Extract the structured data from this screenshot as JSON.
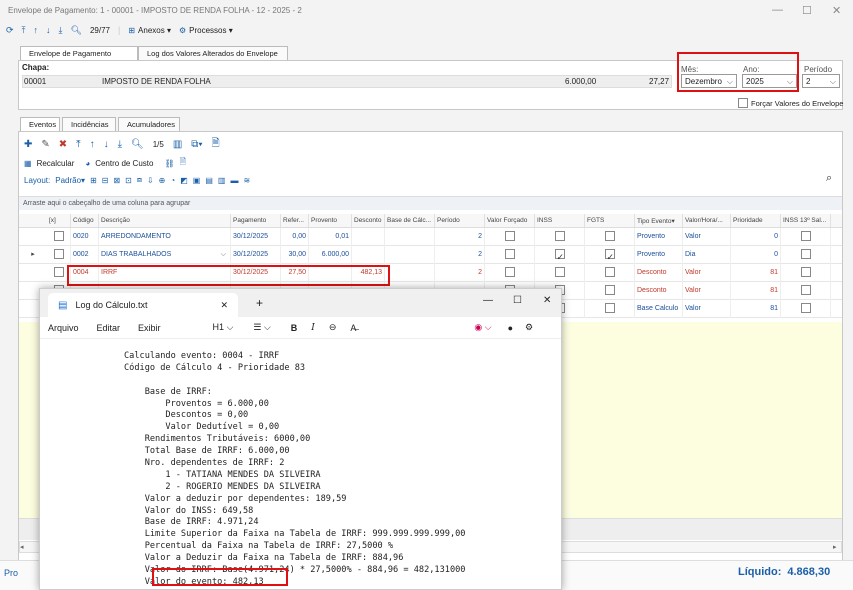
{
  "window": {
    "title": "Envelope de Pagamento: 1 - 00001 - IMPOSTO DE RENDA FOLHA - 12 - 2025 - 2"
  },
  "toolbar": {
    "nav": "29/77",
    "anexos": "Anexos",
    "processos": "Processos"
  },
  "tabs": [
    "Envelope de Pagamento",
    "Log dos Valores Alterados do Envelope"
  ],
  "chapa": {
    "label": "Chapa:",
    "code": "00001",
    "name": "IMPOSTO DE RENDA FOLHA",
    "value1": "6.000,00",
    "value2": "27,27"
  },
  "period": {
    "mes_label": "Mês:",
    "mes": "Dezembro",
    "ano_label": "Ano:",
    "ano": "2025",
    "periodo_label": "Período",
    "periodo": "2",
    "forcar": "Forçar Valores do Envelope"
  },
  "subtabs": [
    "Eventos",
    "Incidências",
    "Acumuladores"
  ],
  "grid_toolbar": {
    "nav": "1/5",
    "recalcular": "Recalcular",
    "centro": "Centro de Custo",
    "layout": "Layout:",
    "padrao": "Padrão"
  },
  "group_hint": "Arraste aqui o cabeçalho de uma coluna para agrupar",
  "columns": [
    "[x]",
    "Código",
    "Descrição",
    "Pagamento",
    "Refer...",
    "Provento",
    "Desconto",
    "Base de Cálc...",
    "Período",
    "Valor Forçado",
    "INSS",
    "FGTS",
    "Tipo Evento",
    "Valor/Hora/...",
    "Prioridade",
    "INSS 13º Sal..."
  ],
  "rows": [
    {
      "codigo": "0020",
      "descricao": "ARREDONDAMENTO",
      "pagamento": "30/12/2025",
      "refer": "0,00",
      "provento": "0,01",
      "desconto": "",
      "periodo": "2",
      "inss": false,
      "fgts": false,
      "tipo": "Provento",
      "valor": "Valor",
      "prioridade": "0"
    },
    {
      "codigo": "0002",
      "descricao": "DIAS TRABALHADOS",
      "pagamento": "30/12/2025",
      "refer": "30,00",
      "provento": "6.000,00",
      "desconto": "",
      "periodo": "2",
      "inss": true,
      "fgts": true,
      "tipo": "Provento",
      "valor": "Dia",
      "prioridade": "0"
    },
    {
      "codigo": "0004",
      "descricao": "IRRF",
      "pagamento": "30/12/2025",
      "refer": "27,50",
      "provento": "",
      "desconto": "482,13",
      "periodo": "2",
      "inss": false,
      "fgts": false,
      "tipo": "Desconto",
      "valor": "Valor",
      "prioridade": "81"
    },
    {
      "codigo": "",
      "descricao": "",
      "pagamento": "",
      "refer": "",
      "provento": "",
      "desconto": "",
      "periodo": "",
      "inss": false,
      "fgts": false,
      "tipo": "Desconto",
      "valor": "Valor",
      "prioridade": "81"
    },
    {
      "codigo": "",
      "descricao": "",
      "pagamento": "",
      "refer": "",
      "provento": "",
      "desconto": "",
      "periodo": "",
      "inss": false,
      "fgts": false,
      "tipo": "Base Calculo",
      "valor": "Valor",
      "prioridade": "81"
    }
  ],
  "footer": {
    "left": "Pro",
    "liquido_label": "Líquido:",
    "liquido": "4.868,30"
  },
  "notepad": {
    "tab_title": "Log do Cálculo.txt",
    "menu": [
      "Arquivo",
      "Editar",
      "Exibir"
    ],
    "heading": "H1",
    "lines": [
      "Calculando evento: 0004 - IRRF",
      "Código de Cálculo 4 - Prioridade 83",
      "",
      "    Base de IRRF:",
      "        Proventos = 6.000,00",
      "        Descontos = 0,00",
      "        Valor Dedutível = 0,00",
      "    Rendimentos Tributáveis: 6000,00",
      "    Total Base de IRRF: 6.000,00",
      "    Nro. dependentes de IRRF: 2",
      "        1 - TATIANA MENDES DA SILVEIRA",
      "        2 - ROGERIO MENDES DA SILVEIRA",
      "    Valor a deduzir por dependentes: 189,59",
      "    Valor do INSS: 649,58",
      "    Base de IRRF: 4.971,24",
      "    Limite Superior da Faixa na Tabela de IRRF: 999.999.999.999,00",
      "    Percentual da Faixa na Tabela de IRRF: 27,5000 %",
      "    Valor a Deduzir da Faixa na Tabela de IRRF: 884,96",
      "    Valor do IRRF: Base(4.971,24) * 27,5000% - 884,96 = 482,131000",
      "    Valor do evento: 482,13"
    ]
  }
}
